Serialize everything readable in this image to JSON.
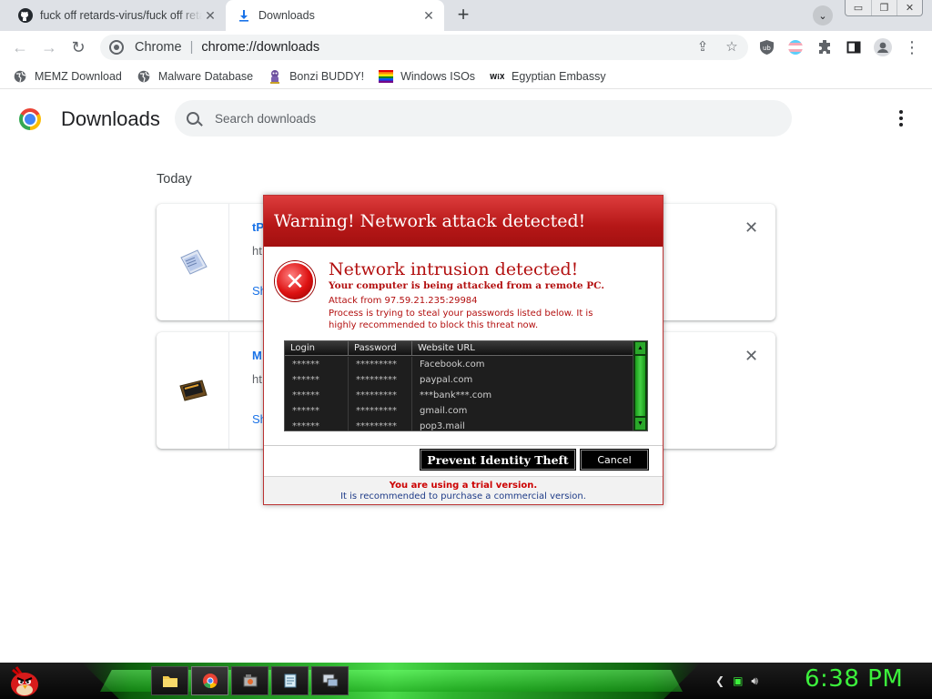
{
  "tabs": [
    {
      "title": "fuck off retards-virus/fuck off retards",
      "icon": "github-icon",
      "close": "✕"
    },
    {
      "title": "Downloads",
      "icon": "download-icon",
      "close": "✕"
    }
  ],
  "new_tab": "+",
  "toolbar": {
    "back": "←",
    "forward": "→",
    "reload": "↻",
    "chip": "Chrome",
    "separator": "|",
    "url": "chrome://downloads",
    "share": "⇪",
    "star": "☆",
    "more": "⋮"
  },
  "bookmarks": [
    {
      "label": "MEMZ Download",
      "icon": "globe-icon"
    },
    {
      "label": "Malware Database",
      "icon": "globe-icon"
    },
    {
      "label": "Bonzi BUDDY!",
      "icon": "bonzi-icon"
    },
    {
      "label": "Windows ISOs",
      "icon": "rainbow-flag-icon"
    },
    {
      "label": "Egyptian Embassy",
      "icon": "wix-icon"
    }
  ],
  "downloads": {
    "title": "Downloads",
    "search_placeholder": "Search downloads",
    "section": "Today",
    "items": [
      {
        "name": "tP",
        "url": "ht",
        "action": "Sh",
        "remove": "✕"
      },
      {
        "name": "M",
        "url": "ht",
        "action": "Sh",
        "remove": "✕"
      }
    ]
  },
  "dialog": {
    "title": "Warning! Network attack detected!",
    "heading": "Network intrusion detected!",
    "subheading": "Your computer is being attacked from a remote PC.",
    "attack_from": "Attack from 97.59.21.235:29984",
    "process_text": "Process is trying to steal your passwords listed below. It is highly recommended to block this threat now.",
    "columns": [
      "Login",
      "Password",
      "Website URL"
    ],
    "rows": [
      [
        "******",
        "*********",
        "Facebook.com"
      ],
      [
        "******",
        "*********",
        "paypal.com"
      ],
      [
        "******",
        "*********",
        "***bank***.com"
      ],
      [
        "******",
        "*********",
        "gmail.com"
      ],
      [
        "******",
        "*********",
        "pop3.mail"
      ]
    ],
    "prevent_button": "Prevent Identity Theft",
    "cancel_button": "Cancel",
    "trial_line": "You are using a trial version.",
    "purchase_line": "It is recommended to purchase a commercial version."
  },
  "taskbar": {
    "clock": "6:38 PM",
    "apps": [
      "file-explorer-icon",
      "chrome-icon",
      "media-icon",
      "notepad-icon",
      "remote-desktop-icon"
    ]
  },
  "colors": {
    "dialog_red": "#b31010",
    "taskbar_green": "#3cf03c",
    "link_blue": "#1a73e8"
  }
}
